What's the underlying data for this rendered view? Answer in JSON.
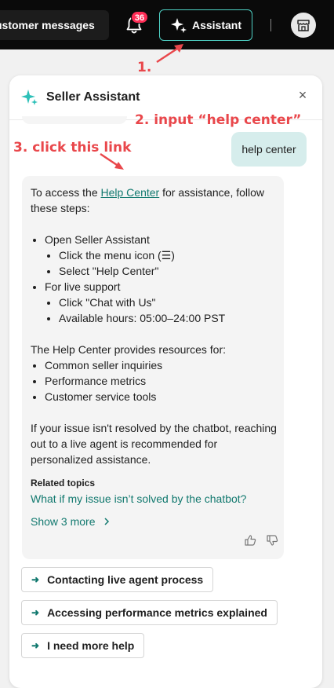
{
  "topbar": {
    "customer_messages_label": "ustomer messages",
    "notification_count": "36",
    "assistant_label": "Assistant"
  },
  "panel": {
    "title": "Seller Assistant",
    "close_symbol": "×",
    "user_message": "help center",
    "reply": {
      "intro_before": "To access the ",
      "intro_link": "Help Center",
      "intro_after": " for assistance, follow these steps:",
      "steps": [
        {
          "label": "Open Seller Assistant",
          "sub": [
            "Click the menu icon (☰)",
            "Select \"Help Center\""
          ]
        },
        {
          "label": "For live support",
          "sub": [
            "Click \"Chat with Us\"",
            "Available hours: 05:00–24:00 PST"
          ]
        }
      ],
      "resources_intro": "The Help Center provides resources for:",
      "resources": [
        "Common seller inquiries",
        "Performance metrics",
        "Customer service tools"
      ],
      "closing": "If your issue isn't resolved by the chatbot, reaching out to a live agent is recommended for personalized assistance.",
      "related_title": "Related topics",
      "related_link": "What if my issue isn’t solved by the chatbot?",
      "show_more": "Show 3 more"
    },
    "suggestions": [
      "Contacting live agent process",
      "Accessing performance metrics explained",
      "I need more help"
    ]
  },
  "annotations": {
    "step1": "1.",
    "step2": "2. input “help center”",
    "step3": "3. click this link"
  },
  "colors": {
    "accent_teal": "#12796f",
    "annotation_red": "#e9474b",
    "badge_red": "#fe2c55"
  }
}
